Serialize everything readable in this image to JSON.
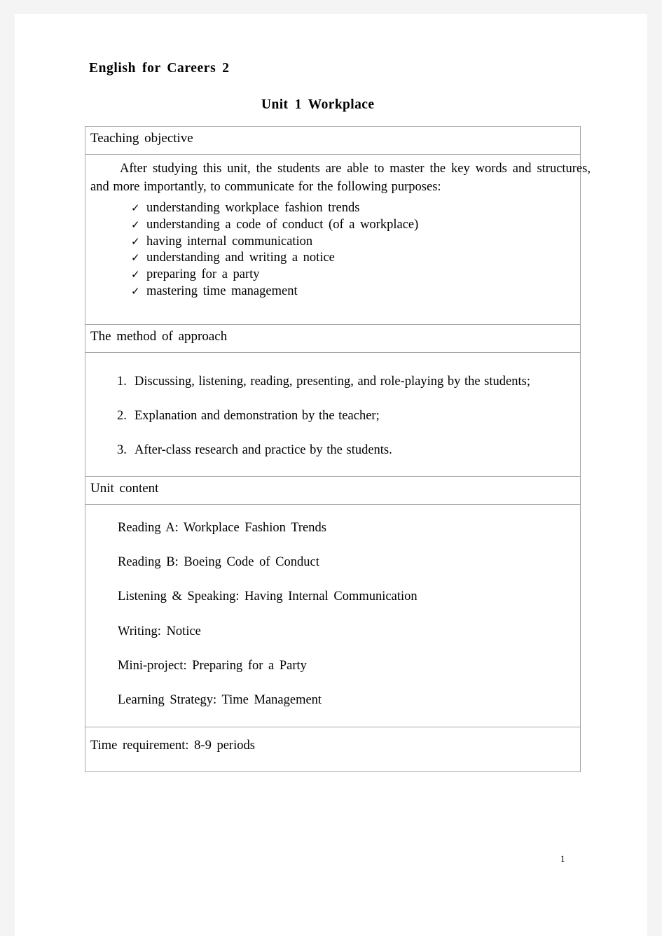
{
  "document": {
    "title": "English for Careers 2",
    "unit_title": "Unit 1  Workplace",
    "page_number": "1"
  },
  "table": {
    "sections": [
      {
        "header": "Teaching  objective",
        "paragraph": "After studying this unit, the students are able to master the key words and structures, and more importantly, to communicate for the following purposes:",
        "bullet_icon": "check-mark-icon",
        "bullets": [
          "understanding  workplace  fashion  trends",
          "understanding  a  code  of  conduct  (of  a  workplace)",
          "having  internal  communication",
          "understanding  and  writing  a  notice",
          "preparing  for  a  party",
          "mastering  time  management"
        ]
      },
      {
        "header": "The  method  of  approach",
        "items": [
          {
            "number": "1.",
            "text": "Discussing, listening, reading, presenting, and role-playing by the students;"
          },
          {
            "number": "2.",
            "text": "Explanation  and  demonstration  by  the  teacher;"
          },
          {
            "number": "3.",
            "text": "After-class  research  and  practice  by  the  students."
          }
        ]
      },
      {
        "header": "Unit  content",
        "lines": [
          "Reading  A:  Workplace  Fashion  Trends",
          "Reading  B:  Boeing  Code  of  Conduct",
          "Listening  &  Speaking:  Having  Internal  Communication",
          "Writing:  Notice",
          "Mini-project:  Preparing  for  a  Party",
          "Learning  Strategy:  Time  Management"
        ]
      },
      {
        "footer": "Time  requirement:  8-9  periods"
      }
    ]
  },
  "colors": {
    "page_background": "#ffffff",
    "gutter": "#f4f4f5",
    "table_border": "#a6a6a6",
    "text": "#000000"
  }
}
